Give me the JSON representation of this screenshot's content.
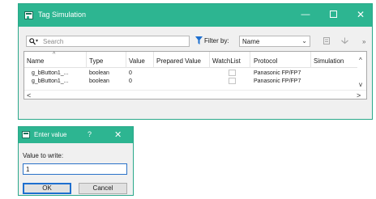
{
  "window": {
    "title": "Tag Simulation",
    "minimize_glyph": "—",
    "close_glyph": "✕"
  },
  "toolbar": {
    "search_placeholder": "Search",
    "search_dropdown_glyph": "▾",
    "filter_label": "Filter by:",
    "filter_value": "Name",
    "filter_arrow": "⌄",
    "more_glyph": "»",
    "icons": [
      "search-icon",
      "filter-icon",
      "import-icon",
      "save-icon"
    ]
  },
  "grid": {
    "columns": [
      "Name",
      "Type",
      "Value",
      "Prepared Value",
      "WatchList",
      "Protocol",
      "Simulation"
    ],
    "sort_indicator": "^",
    "rows": [
      {
        "name": "g_bButton1_...",
        "type": "boolean",
        "value": "0",
        "prepared_value": "",
        "watchlist": false,
        "protocol": "Panasonic FP/FP7",
        "simulation": ""
      },
      {
        "name": "g_bButton1_...",
        "type": "boolean",
        "value": "0",
        "prepared_value": "",
        "watchlist": false,
        "protocol": "Panasonic FP/FP7",
        "simulation": ""
      }
    ],
    "scroll_up": "^",
    "scroll_down": "v",
    "scroll_left": "<",
    "scroll_right": ">"
  },
  "dialog": {
    "title": "Enter value",
    "help_glyph": "?",
    "close_glyph": "✕",
    "label": "Value to write:",
    "input_value": "1",
    "ok_label": "OK",
    "cancel_label": "Cancel"
  },
  "colors": {
    "titlebar": "#2db591",
    "focus_border": "#1e6fcf"
  }
}
